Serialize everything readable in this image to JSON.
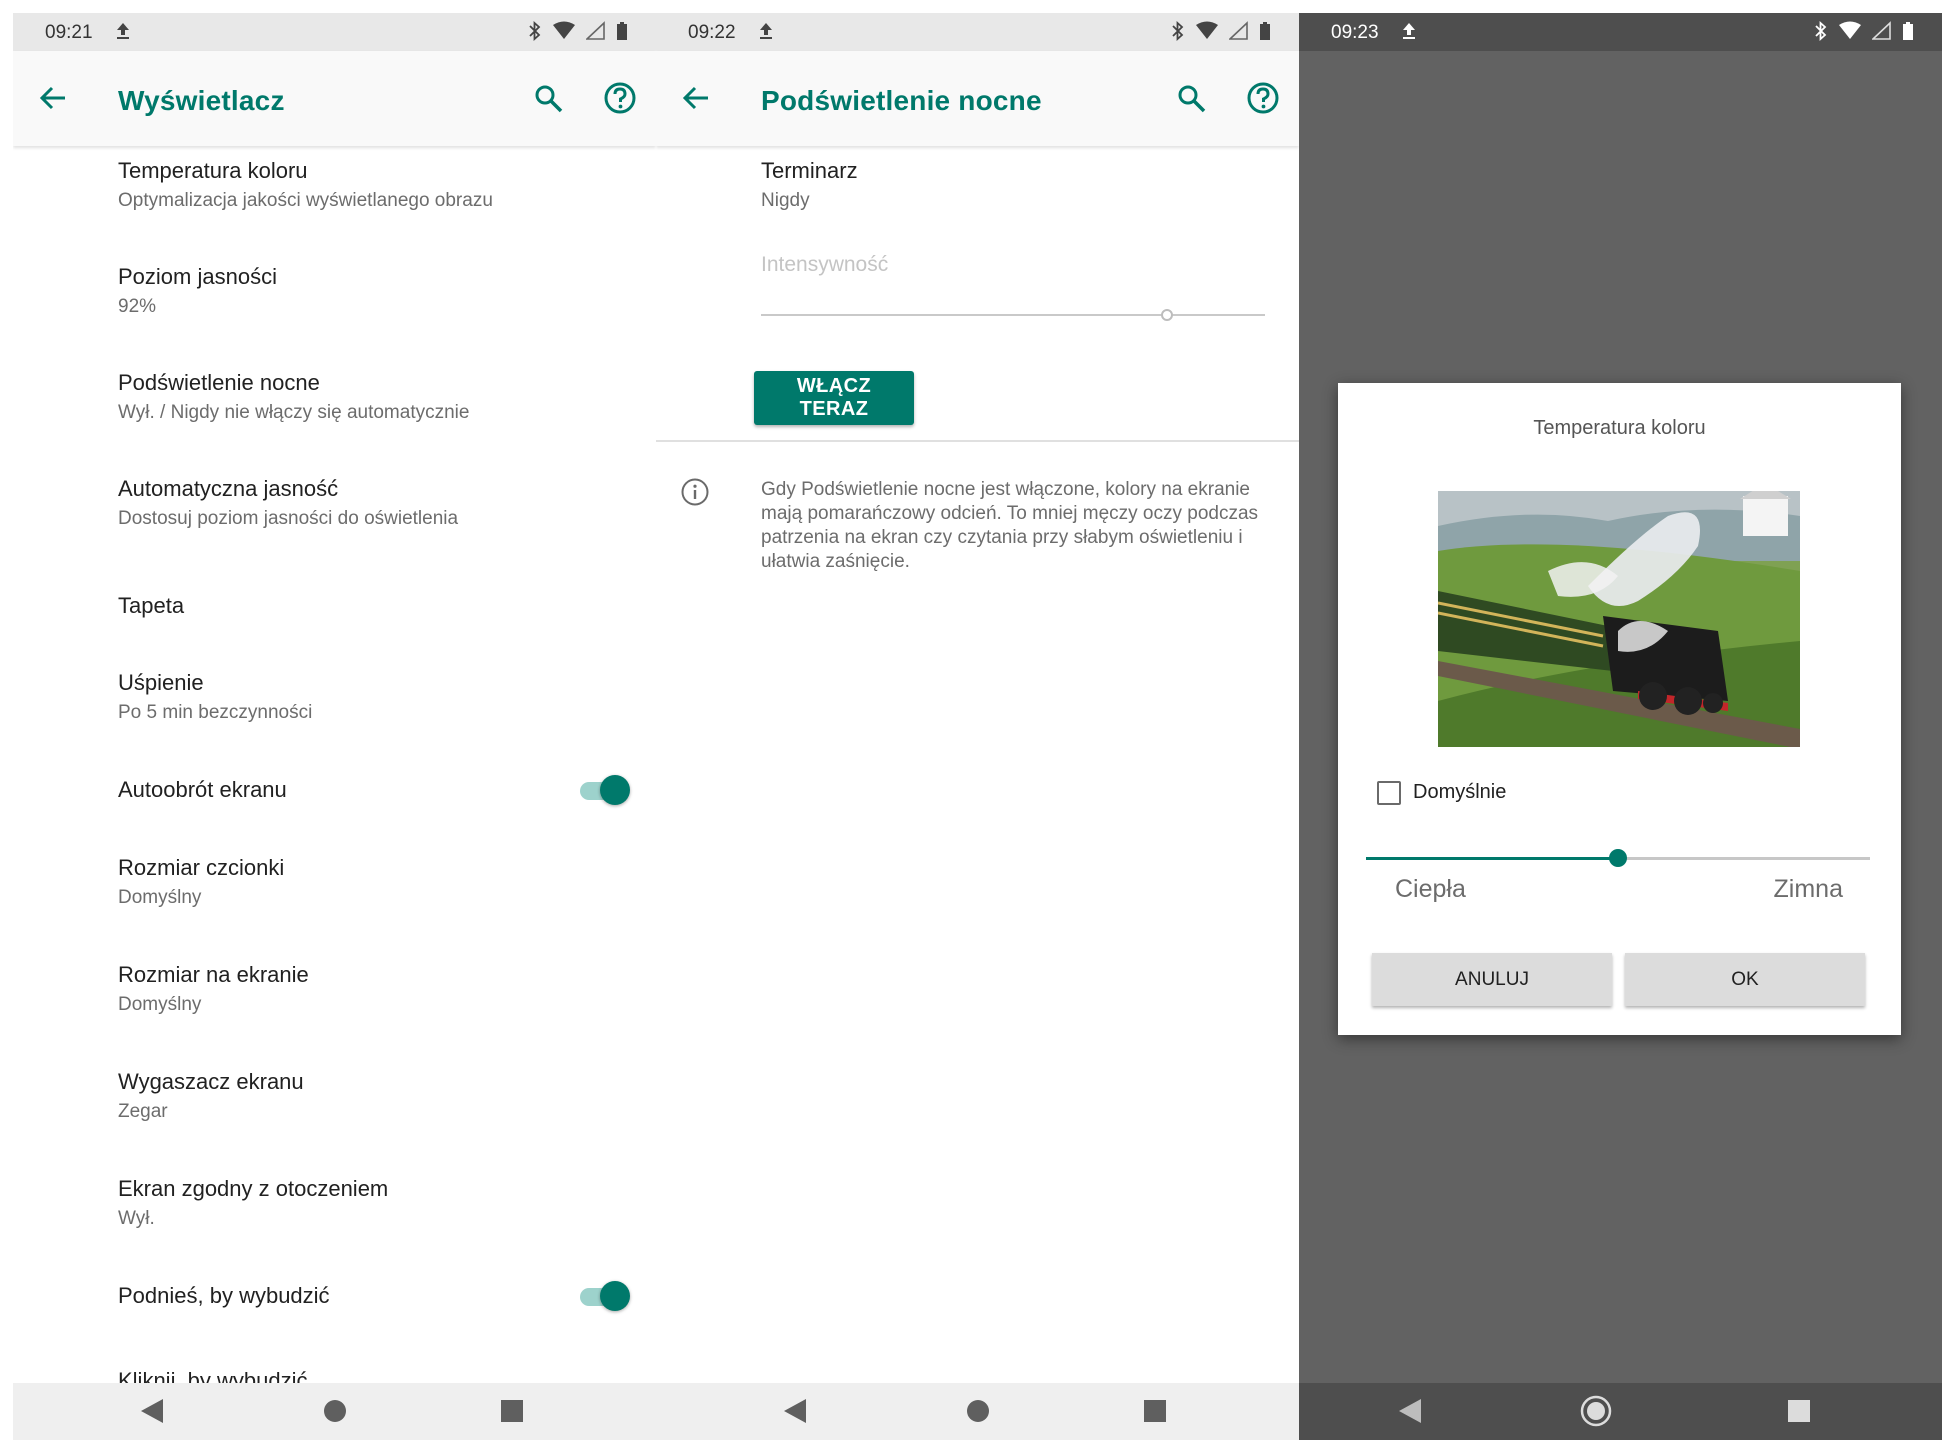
{
  "screen1": {
    "status_time": "09:21",
    "title": "Wyświetlacz",
    "items": [
      {
        "title": "Temperatura koloru",
        "subtitle": "Optymalizacja jakości wyświetlanego obrazu"
      },
      {
        "title": "Poziom jasności",
        "subtitle": "92%"
      },
      {
        "title": "Podświetlenie nocne",
        "subtitle": "Wył. / Nigdy nie włączy się automatycznie"
      },
      {
        "title": "Automatyczna jasność",
        "subtitle": "Dostosuj poziom jasności do oświetlenia"
      },
      {
        "title": "Tapeta",
        "subtitle": ""
      },
      {
        "title": "Uśpienie",
        "subtitle": "Po 5 min bezczynności"
      },
      {
        "title": "Autoobrót ekranu",
        "subtitle": "",
        "toggle": true
      },
      {
        "title": "Rozmiar czcionki",
        "subtitle": "Domyślny"
      },
      {
        "title": "Rozmiar na ekranie",
        "subtitle": "Domyślny"
      },
      {
        "title": "Wygaszacz ekranu",
        "subtitle": "Zegar"
      },
      {
        "title": "Ekran zgodny z otoczeniem",
        "subtitle": "Wył."
      },
      {
        "title": "Podnieś, by wybudzić",
        "subtitle": "",
        "toggle": true
      }
    ],
    "cutoff_item": "Kliknij, by wybudzić"
  },
  "screen2": {
    "status_time": "09:22",
    "title": "Podświetlenie nocne",
    "schedule_title": "Terminarz",
    "schedule_value": "Nigdy",
    "intensity_label": "Intensywność",
    "enable_button": "WŁĄCZ TERAZ",
    "info_text": "Gdy Podświetlenie nocne jest włączone, kolory na ekranie mają pomarańczowy odcień. To mniej męczy oczy podczas patrzenia na ekran czy czytania przy słabym oświetleniu i ułatwia zaśnięcie."
  },
  "screen3": {
    "status_time": "09:23",
    "dialog_title": "Temperatura koloru",
    "checkbox_label": "Domyślnie",
    "checkbox_checked": false,
    "slider_value": 0.5,
    "warm_label": "Ciepła",
    "cold_label": "Zimna",
    "cancel_label": "ANULUJ",
    "ok_label": "OK"
  },
  "colors": {
    "accent": "#00796b",
    "toggle_track": "#9dd2cc",
    "dim_background": "#626262"
  },
  "icons": [
    "back-arrow-icon",
    "search-icon",
    "help-icon",
    "upload-icon",
    "bluetooth-icon",
    "wifi-icon",
    "signal-icon",
    "battery-icon",
    "info-icon",
    "nav-back-icon",
    "nav-home-icon",
    "nav-recents-icon"
  ]
}
